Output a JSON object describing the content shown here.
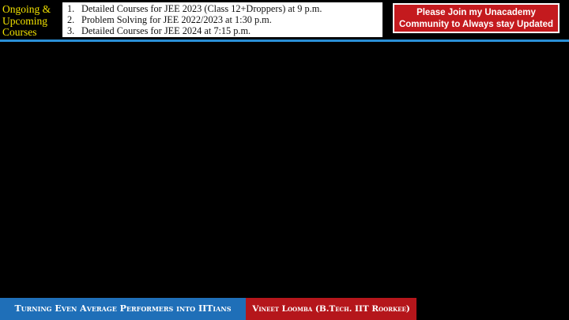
{
  "header": {
    "courses_heading_lines": [
      "Ongoing &",
      "Upcoming",
      "Courses"
    ],
    "courses": [
      {
        "num": "1.",
        "text": "Detailed Courses for JEE 2023 (Class 12+Droppers) at 9 p.m."
      },
      {
        "num": "2.",
        "text": "Problem Solving for JEE 2022/2023 at 1:30 p.m."
      },
      {
        "num": "3.",
        "text": "Detailed Courses for JEE 2024 at 7:15 p.m."
      }
    ],
    "join_lines": [
      "Please Join my Unacademy",
      "Community to Always stay Updated"
    ]
  },
  "footer": {
    "tagline": "Turning Even Average Performers into IITians",
    "presenter": "Vineet Loomba (B.Tech. IIT Roorkee)"
  },
  "colors": {
    "heading_yellow": "#f2e200",
    "join_red": "#c41a1e",
    "divider_blue": "#2a8fd6",
    "tagline_blue": "#1f6fb8",
    "presenter_red": "#b5161b"
  }
}
